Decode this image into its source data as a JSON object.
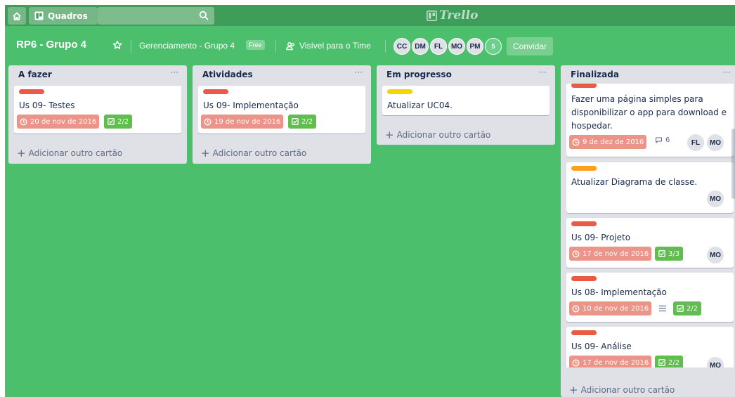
{
  "topbar": {
    "boards_label": "Quadros",
    "logo_text": "Trello"
  },
  "board": {
    "name": "RP6 - Grupo 4",
    "team": "Gerenciamento - Grupo 4",
    "plan": "Free",
    "visibility": "Visível para o Time",
    "members": [
      "CC",
      "DM",
      "FL",
      "MO",
      "PM"
    ],
    "member_count": "5",
    "invite_label": "Convidar"
  },
  "lists": [
    {
      "title": "A fazer",
      "menu": "···",
      "add_label": "Adicionar outro cartão",
      "cards": [
        {
          "label_color": "red",
          "title": "Us 09- Testes",
          "due": "20 de nov de 2016",
          "checklist": "2/2"
        }
      ]
    },
    {
      "title": "Atividades",
      "menu": "···",
      "add_label": "Adicionar outro cartão",
      "cards": [
        {
          "label_color": "red",
          "title": "Us 09- Implementação",
          "due": "19 de nov de 2016",
          "checklist": "2/2"
        }
      ]
    },
    {
      "title": "Em progresso",
      "menu": "···",
      "add_label": "Adicionar outro cartão",
      "cards": [
        {
          "label_color": "yellow",
          "title": "Atualizar UC04."
        }
      ]
    },
    {
      "title": "Finalizada",
      "menu": "···",
      "add_label": "Adicionar outro cartão",
      "cards": [
        {
          "label_color": "red",
          "title": "Fazer uma página simples para disponibilizar o app para download e hospedar.",
          "due": "9 de dez de 2016",
          "comments": "6",
          "members": [
            "FL",
            "MO"
          ]
        },
        {
          "label_color": "orange",
          "title": "Atualizar Diagrama de classe.",
          "members": [
            "MO"
          ]
        },
        {
          "label_color": "red",
          "title": "Us 09- Projeto",
          "due": "17 de nov de 2016",
          "checklist": "3/3",
          "members": [
            "MO"
          ]
        },
        {
          "label_color": "red",
          "title": "Us 08- Implementação",
          "due": "10 de nov de 2016",
          "has_description": true,
          "checklist": "2/2"
        },
        {
          "label_color": "red",
          "title": "Us 09- Análise",
          "due": "17 de nov de 2016",
          "checklist": "2/2",
          "members": [
            "MO"
          ]
        }
      ]
    }
  ],
  "colors": {
    "board_bg": "#4bbf6b",
    "topbar": "#3e9d58",
    "label_red": "#eb5a46",
    "label_yellow": "#f2d600",
    "label_orange": "#ff9f1a",
    "due_past": "#ec9488",
    "checklist_done": "#61bd4f"
  }
}
